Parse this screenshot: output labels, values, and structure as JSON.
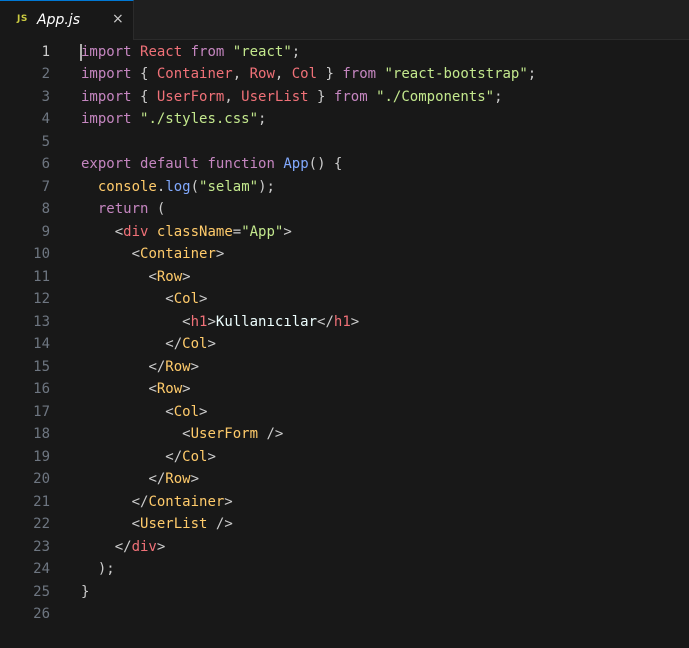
{
  "tab": {
    "icon_label": "JS",
    "title": "App.js",
    "close_glyph": "×"
  },
  "lines": [
    {
      "n": "1",
      "tokens": [
        {
          "c": "kw",
          "t": "import"
        },
        {
          "c": "pun",
          "t": " "
        },
        {
          "c": "cls",
          "t": "React"
        },
        {
          "c": "pun",
          "t": " "
        },
        {
          "c": "kw",
          "t": "from"
        },
        {
          "c": "pun",
          "t": " "
        },
        {
          "c": "str",
          "t": "\"react\""
        },
        {
          "c": "pun",
          "t": ";"
        }
      ]
    },
    {
      "n": "2",
      "tokens": [
        {
          "c": "kw",
          "t": "import"
        },
        {
          "c": "pun",
          "t": " { "
        },
        {
          "c": "cls",
          "t": "Container"
        },
        {
          "c": "pun",
          "t": ", "
        },
        {
          "c": "cls",
          "t": "Row"
        },
        {
          "c": "pun",
          "t": ", "
        },
        {
          "c": "cls",
          "t": "Col"
        },
        {
          "c": "pun",
          "t": " } "
        },
        {
          "c": "kw",
          "t": "from"
        },
        {
          "c": "pun",
          "t": " "
        },
        {
          "c": "str",
          "t": "\"react-bootstrap\""
        },
        {
          "c": "pun",
          "t": ";"
        }
      ]
    },
    {
      "n": "3",
      "tokens": [
        {
          "c": "kw",
          "t": "import"
        },
        {
          "c": "pun",
          "t": " { "
        },
        {
          "c": "cls",
          "t": "UserForm"
        },
        {
          "c": "pun",
          "t": ", "
        },
        {
          "c": "cls",
          "t": "UserList"
        },
        {
          "c": "pun",
          "t": " } "
        },
        {
          "c": "kw",
          "t": "from"
        },
        {
          "c": "pun",
          "t": " "
        },
        {
          "c": "str",
          "t": "\"./Components\""
        },
        {
          "c": "pun",
          "t": ";"
        }
      ]
    },
    {
      "n": "4",
      "tokens": [
        {
          "c": "kw",
          "t": "import"
        },
        {
          "c": "pun",
          "t": " "
        },
        {
          "c": "str",
          "t": "\"./styles.css\""
        },
        {
          "c": "pun",
          "t": ";"
        }
      ]
    },
    {
      "n": "5",
      "tokens": []
    },
    {
      "n": "6",
      "tokens": [
        {
          "c": "kw",
          "t": "export"
        },
        {
          "c": "pun",
          "t": " "
        },
        {
          "c": "kw",
          "t": "default"
        },
        {
          "c": "pun",
          "t": " "
        },
        {
          "c": "kw",
          "t": "function"
        },
        {
          "c": "pun",
          "t": " "
        },
        {
          "c": "fn",
          "t": "App"
        },
        {
          "c": "pun",
          "t": "() {"
        }
      ]
    },
    {
      "n": "7",
      "tokens": [
        {
          "c": "pun",
          "t": "  "
        },
        {
          "c": "obj",
          "t": "console"
        },
        {
          "c": "pun",
          "t": "."
        },
        {
          "c": "fn",
          "t": "log"
        },
        {
          "c": "pun",
          "t": "("
        },
        {
          "c": "str",
          "t": "\"selam\""
        },
        {
          "c": "pun",
          "t": ");"
        }
      ]
    },
    {
      "n": "8",
      "tokens": [
        {
          "c": "pun",
          "t": "  "
        },
        {
          "c": "kw",
          "t": "return"
        },
        {
          "c": "pun",
          "t": " ("
        }
      ]
    },
    {
      "n": "9",
      "tokens": [
        {
          "c": "pun",
          "t": "    "
        },
        {
          "c": "tagb",
          "t": "<"
        },
        {
          "c": "tagh",
          "t": "div"
        },
        {
          "c": "pun",
          "t": " "
        },
        {
          "c": "attr",
          "t": "className"
        },
        {
          "c": "pun",
          "t": "="
        },
        {
          "c": "str",
          "t": "\"App\""
        },
        {
          "c": "tagb",
          "t": ">"
        }
      ]
    },
    {
      "n": "10",
      "tokens": [
        {
          "c": "pun",
          "t": "      "
        },
        {
          "c": "tagb",
          "t": "<"
        },
        {
          "c": "comp",
          "t": "Container"
        },
        {
          "c": "tagb",
          "t": ">"
        }
      ]
    },
    {
      "n": "11",
      "tokens": [
        {
          "c": "pun",
          "t": "        "
        },
        {
          "c": "tagb",
          "t": "<"
        },
        {
          "c": "comp",
          "t": "Row"
        },
        {
          "c": "tagb",
          "t": ">"
        }
      ]
    },
    {
      "n": "12",
      "tokens": [
        {
          "c": "pun",
          "t": "          "
        },
        {
          "c": "tagb",
          "t": "<"
        },
        {
          "c": "comp",
          "t": "Col"
        },
        {
          "c": "tagb",
          "t": ">"
        }
      ]
    },
    {
      "n": "13",
      "tokens": [
        {
          "c": "pun",
          "t": "            "
        },
        {
          "c": "tagb",
          "t": "<"
        },
        {
          "c": "tagh",
          "t": "h1"
        },
        {
          "c": "tagb",
          "t": ">"
        },
        {
          "c": "plain",
          "t": "Kullanıcılar"
        },
        {
          "c": "tagb",
          "t": "</"
        },
        {
          "c": "tagh",
          "t": "h1"
        },
        {
          "c": "tagb",
          "t": ">"
        }
      ]
    },
    {
      "n": "14",
      "tokens": [
        {
          "c": "pun",
          "t": "          "
        },
        {
          "c": "tagb",
          "t": "</"
        },
        {
          "c": "comp",
          "t": "Col"
        },
        {
          "c": "tagb",
          "t": ">"
        }
      ]
    },
    {
      "n": "15",
      "tokens": [
        {
          "c": "pun",
          "t": "        "
        },
        {
          "c": "tagb",
          "t": "</"
        },
        {
          "c": "comp",
          "t": "Row"
        },
        {
          "c": "tagb",
          "t": ">"
        }
      ]
    },
    {
      "n": "16",
      "tokens": [
        {
          "c": "pun",
          "t": "        "
        },
        {
          "c": "tagb",
          "t": "<"
        },
        {
          "c": "comp",
          "t": "Row"
        },
        {
          "c": "tagb",
          "t": ">"
        }
      ]
    },
    {
      "n": "17",
      "tokens": [
        {
          "c": "pun",
          "t": "          "
        },
        {
          "c": "tagb",
          "t": "<"
        },
        {
          "c": "comp",
          "t": "Col"
        },
        {
          "c": "tagb",
          "t": ">"
        }
      ]
    },
    {
      "n": "18",
      "tokens": [
        {
          "c": "pun",
          "t": "            "
        },
        {
          "c": "tagb",
          "t": "<"
        },
        {
          "c": "comp",
          "t": "UserForm"
        },
        {
          "c": "pun",
          "t": " "
        },
        {
          "c": "tagb",
          "t": "/>"
        }
      ]
    },
    {
      "n": "19",
      "tokens": [
        {
          "c": "pun",
          "t": "          "
        },
        {
          "c": "tagb",
          "t": "</"
        },
        {
          "c": "comp",
          "t": "Col"
        },
        {
          "c": "tagb",
          "t": ">"
        }
      ]
    },
    {
      "n": "20",
      "tokens": [
        {
          "c": "pun",
          "t": "        "
        },
        {
          "c": "tagb",
          "t": "</"
        },
        {
          "c": "comp",
          "t": "Row"
        },
        {
          "c": "tagb",
          "t": ">"
        }
      ]
    },
    {
      "n": "21",
      "tokens": [
        {
          "c": "pun",
          "t": "      "
        },
        {
          "c": "tagb",
          "t": "</"
        },
        {
          "c": "comp",
          "t": "Container"
        },
        {
          "c": "tagb",
          "t": ">"
        }
      ]
    },
    {
      "n": "22",
      "tokens": [
        {
          "c": "pun",
          "t": "      "
        },
        {
          "c": "tagb",
          "t": "<"
        },
        {
          "c": "comp",
          "t": "UserList"
        },
        {
          "c": "pun",
          "t": " "
        },
        {
          "c": "tagb",
          "t": "/>"
        }
      ]
    },
    {
      "n": "23",
      "tokens": [
        {
          "c": "pun",
          "t": "    "
        },
        {
          "c": "tagb",
          "t": "</"
        },
        {
          "c": "tagh",
          "t": "div"
        },
        {
          "c": "tagb",
          "t": ">"
        }
      ]
    },
    {
      "n": "24",
      "tokens": [
        {
          "c": "pun",
          "t": "  );"
        }
      ]
    },
    {
      "n": "25",
      "tokens": [
        {
          "c": "pun",
          "t": "}"
        }
      ]
    },
    {
      "n": "26",
      "tokens": []
    }
  ]
}
